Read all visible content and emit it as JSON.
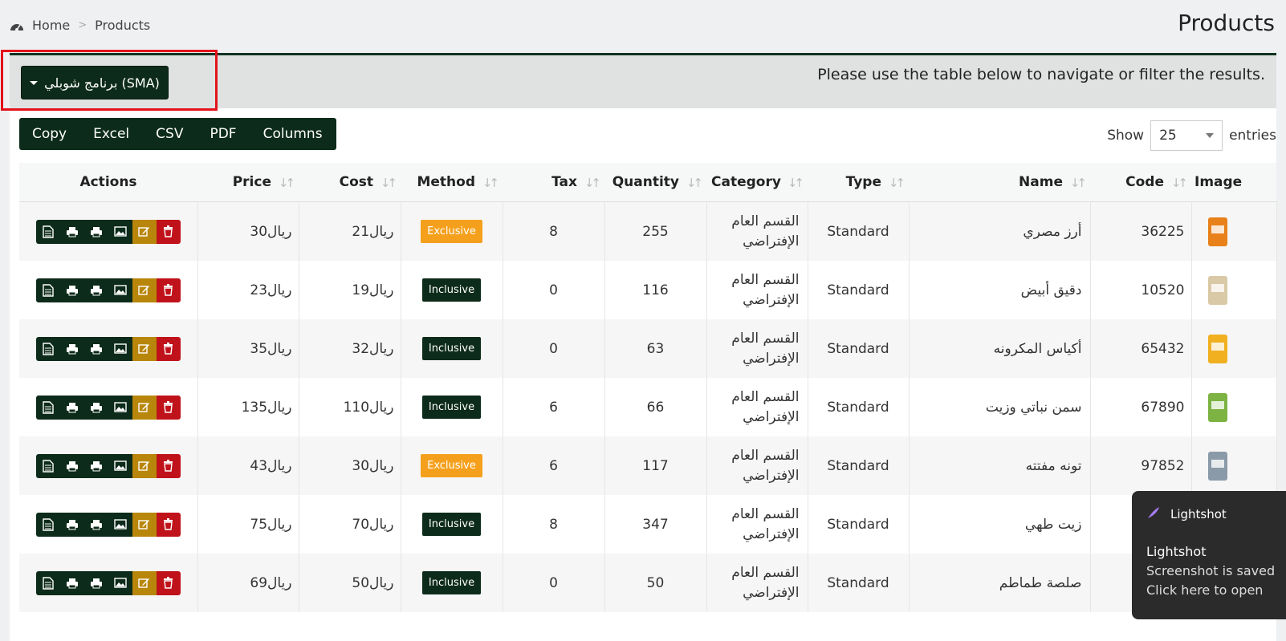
{
  "breadcrumb": {
    "home": "Home",
    "separator": ">",
    "current": "Products"
  },
  "page_title": "Products",
  "info_text": "Please use the table below to navigate or filter the results.",
  "warehouse_button": "برنامج شوبلي (SMA)",
  "export_buttons": [
    "Copy",
    "Excel",
    "CSV",
    "PDF",
    "Columns"
  ],
  "length": {
    "show": "Show",
    "value": "25",
    "entries": "entries"
  },
  "columns": {
    "image": "Image",
    "code": "Code",
    "name": "Name",
    "type": "Type",
    "category": "Category",
    "quantity": "Quantity",
    "tax": "Tax",
    "method": "Method",
    "cost": "Cost",
    "price": "Price",
    "actions": "Actions"
  },
  "rows": [
    {
      "code": "36225",
      "name": "أرز مصري",
      "type": "Standard",
      "category_line1": "القسم العام",
      "category_line2": "الإفتراضي",
      "quantity": "255",
      "tax": "8",
      "method": "Exclusive",
      "cost": "21ريال",
      "price": "30ريال"
    },
    {
      "code": "10520",
      "name": "دقيق أبيض",
      "type": "Standard",
      "category_line1": "القسم العام",
      "category_line2": "الإفتراضي",
      "quantity": "116",
      "tax": "0",
      "method": "Inclusive",
      "cost": "19ريال",
      "price": "23ريال"
    },
    {
      "code": "65432",
      "name": "أكياس المكرونه",
      "type": "Standard",
      "category_line1": "القسم العام",
      "category_line2": "الإفتراضي",
      "quantity": "63",
      "tax": "0",
      "method": "Inclusive",
      "cost": "32ريال",
      "price": "35ريال"
    },
    {
      "code": "67890",
      "name": "سمن نباتي وزيت",
      "type": "Standard",
      "category_line1": "القسم العام",
      "category_line2": "الإفتراضي",
      "quantity": "66",
      "tax": "6",
      "method": "Inclusive",
      "cost": "110ريال",
      "price": "135ريال"
    },
    {
      "code": "97852",
      "name": "تونه مفتته",
      "type": "Standard",
      "category_line1": "القسم العام",
      "category_line2": "الإفتراضي",
      "quantity": "117",
      "tax": "6",
      "method": "Exclusive",
      "cost": "30ريال",
      "price": "43ريال"
    },
    {
      "code": "",
      "name": "زيت طهي",
      "type": "Standard",
      "category_line1": "القسم العام",
      "category_line2": "الإفتراضي",
      "quantity": "347",
      "tax": "8",
      "method": "Inclusive",
      "cost": "70ريال",
      "price": "75ريال"
    },
    {
      "code": "",
      "name": "صلصة طماطم",
      "type": "Standard",
      "category_line1": "القسم العام",
      "category_line2": "الإفتراضي",
      "quantity": "50",
      "tax": "0",
      "method": "Inclusive",
      "cost": "50ريال",
      "price": "69ريال"
    }
  ],
  "toast": {
    "app": "Lightshot",
    "title": "Lightshot",
    "line1": "Screenshot is saved",
    "line2": "Click here to open"
  },
  "colors": {
    "primary": "#0d2b1a",
    "exclusive": "#f5a01c",
    "edit": "#b8860b",
    "delete": "#c0121a",
    "highlight": "#e3121b"
  }
}
